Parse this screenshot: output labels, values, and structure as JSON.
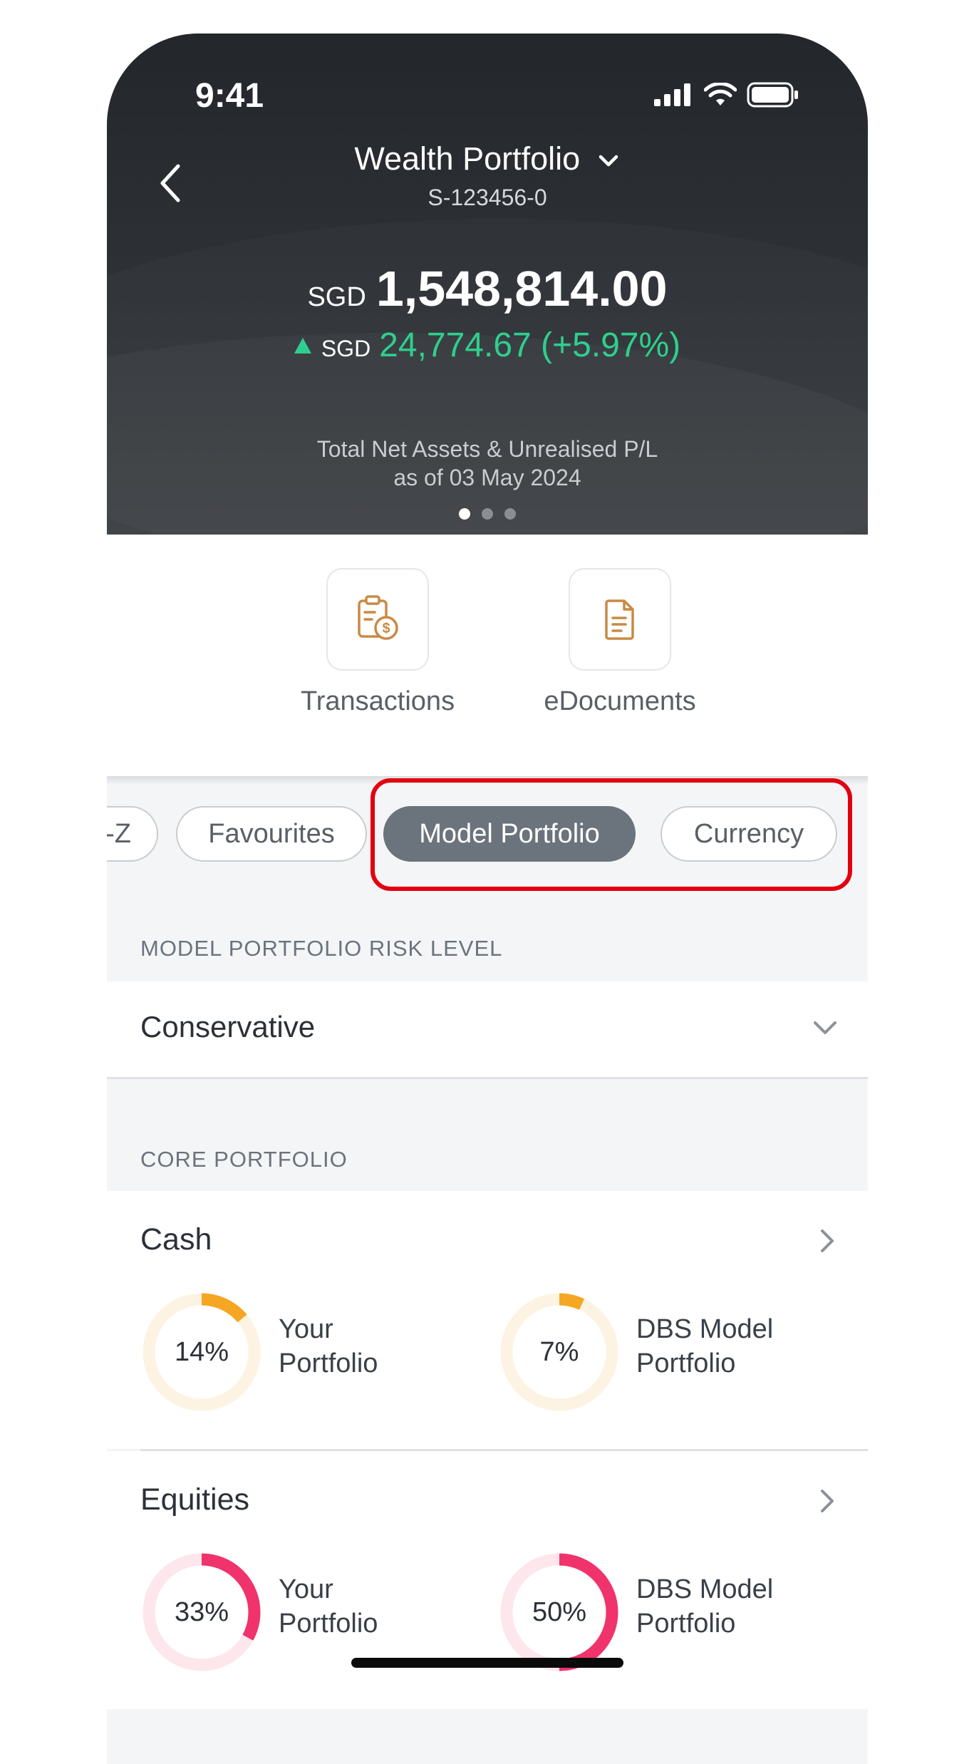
{
  "status_bar": {
    "time": "9:41"
  },
  "header": {
    "title": "Wealth Portfolio",
    "account_number": "S-123456-0",
    "currency": "SGD",
    "total_value": "1,548,814.00",
    "pl_currency": "SGD",
    "pl_value": "24,774.67 (+5.97%)",
    "caption_line1": "Total Net Assets & Unrealised P/L",
    "caption_line2": "as of 03 May 2024",
    "page_indicator": {
      "count": 3,
      "active": 1
    }
  },
  "quick_actions": [
    {
      "label": "Transactions",
      "icon": "receipt-dollar-icon"
    },
    {
      "label": "eDocuments",
      "icon": "document-icon"
    }
  ],
  "filter_chips": [
    {
      "label": "-Z",
      "active": false
    },
    {
      "label": "Favourites",
      "active": false
    },
    {
      "label": "Model Portfolio",
      "active": true
    },
    {
      "label": "Currency",
      "active": false
    }
  ],
  "risk_section": {
    "heading": "MODEL PORTFOLIO RISK LEVEL",
    "selected": "Conservative"
  },
  "core_section": {
    "heading": "CORE PORTFOLIO",
    "assets": [
      {
        "name": "Cash",
        "color": "#f5a623",
        "track_color": "#fdf3e3",
        "your_portfolio": {
          "value": 14,
          "text": "14%",
          "label_line1": "Your",
          "label_line2": "Portfolio"
        },
        "model_portfolio": {
          "value": 7,
          "text": "7%",
          "label_line1": "DBS Model",
          "label_line2": "Portfolio"
        }
      },
      {
        "name": "Equities",
        "color": "#f0336c",
        "track_color": "#fde6ec",
        "your_portfolio": {
          "value": 33,
          "text": "33%",
          "label_line1": "Your",
          "label_line2": "Portfolio"
        },
        "model_portfolio": {
          "value": 50,
          "text": "50%",
          "label_line1": "DBS Model",
          "label_line2": "Portfolio"
        }
      }
    ]
  },
  "colors": {
    "header_bg": "#2a2e32",
    "gain": "#2ecf8e",
    "chip_active": "#6b737c",
    "highlight": "#e3000f",
    "icon_accent": "#c98a45"
  }
}
